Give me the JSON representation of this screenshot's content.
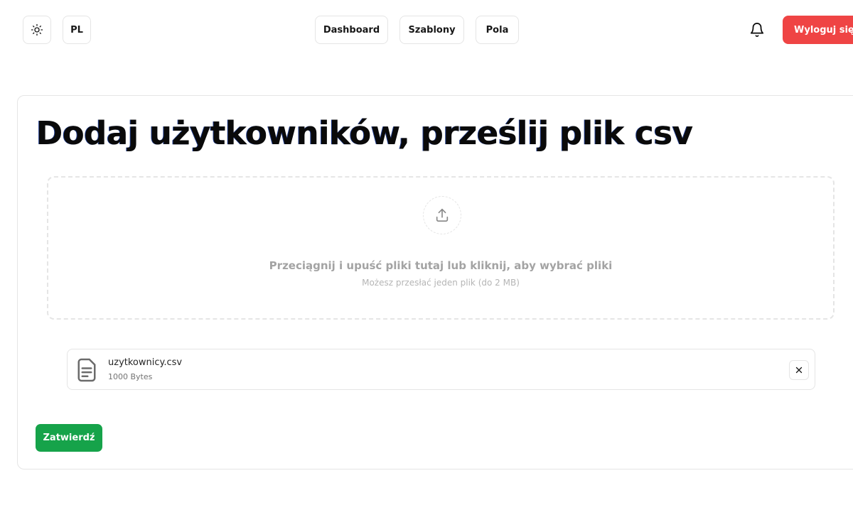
{
  "header": {
    "theme_icon": "sun-icon",
    "language_label": "PL",
    "nav": [
      {
        "label": "Dashboard"
      },
      {
        "label": "Szablony"
      },
      {
        "label": "Pola"
      }
    ],
    "notifications_icon": "bell-icon",
    "logout_label": "Wyloguj się"
  },
  "main": {
    "title": "Dodaj użytkowników, prześlij plik csv",
    "dropzone": {
      "icon": "upload-icon",
      "main_text": "Przeciągnij i upuść pliki tutaj lub kliknij, aby wybrać pliki",
      "sub_text": "Możesz przesłać jeden plik (do 2 MB)"
    },
    "file": {
      "icon": "file-text-icon",
      "name": "uzytkownicy.csv",
      "size": "1000 Bytes",
      "remove_icon": "close-icon"
    },
    "submit_label": "Zatwierdź"
  },
  "colors": {
    "danger": "#ef4444",
    "success": "#16a34a",
    "border": "#e5e5e5",
    "muted_text": "#a3a3a3"
  }
}
